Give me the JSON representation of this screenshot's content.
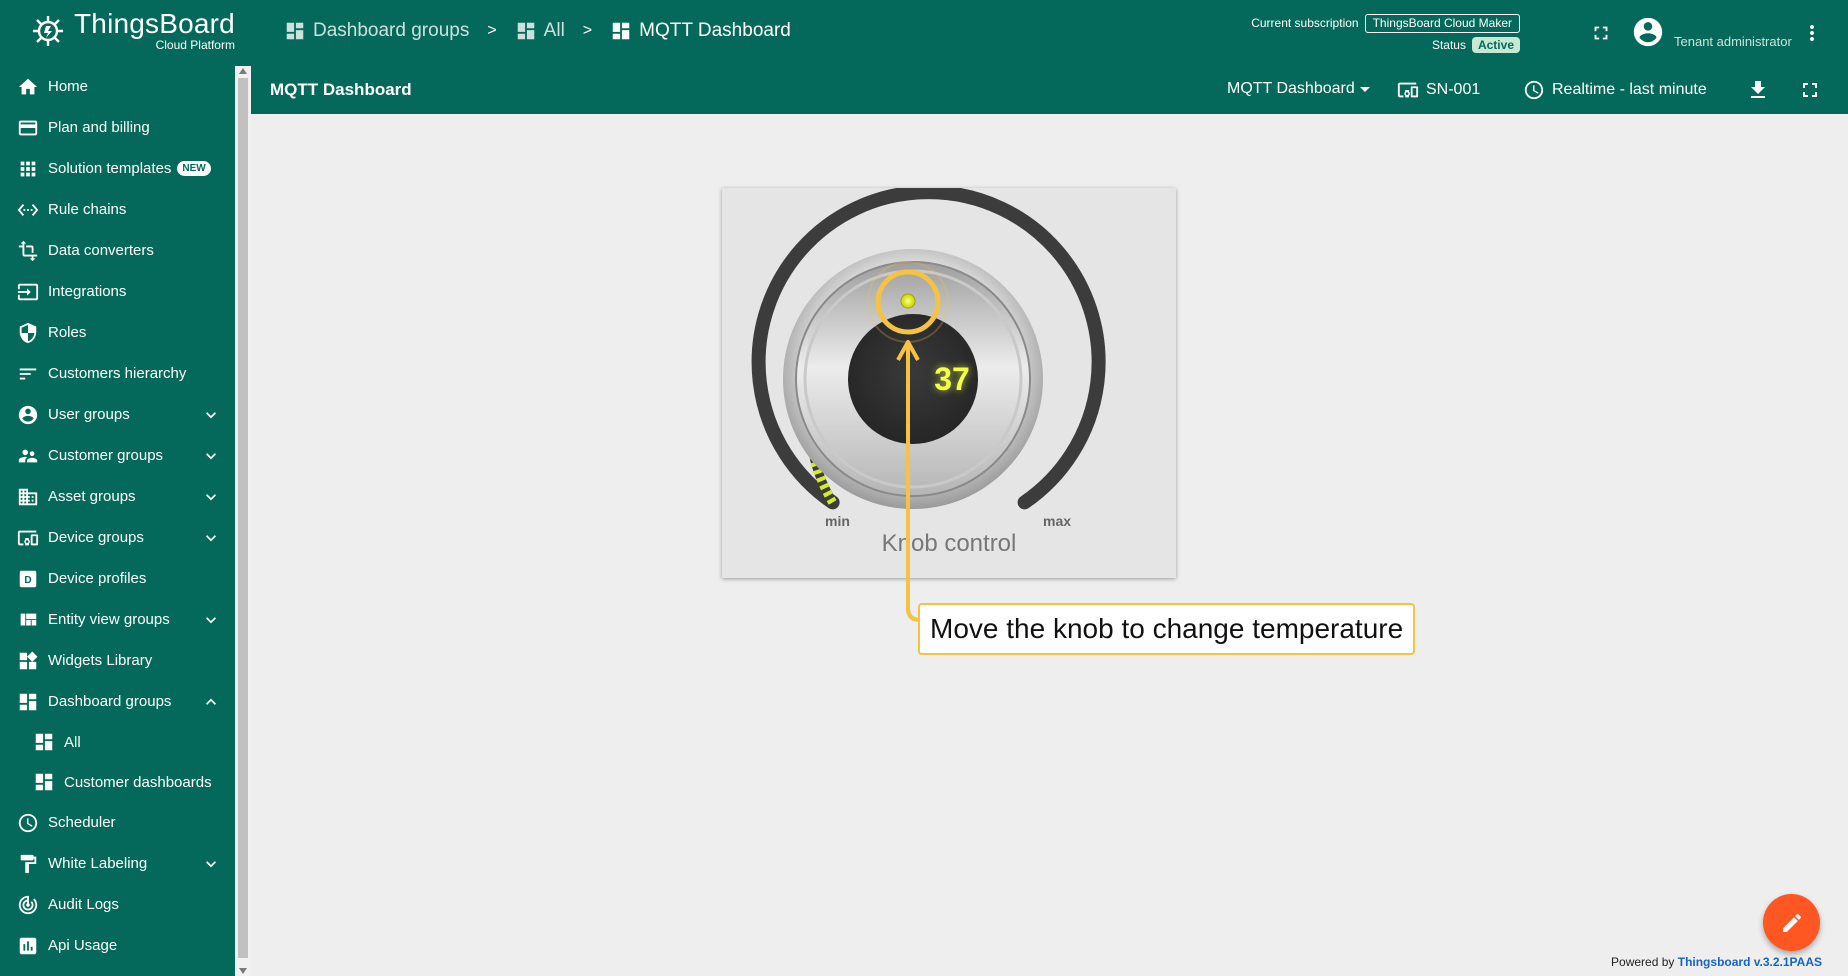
{
  "app": {
    "logo_title": "ThingsBoard",
    "logo_subtitle": "Cloud Platform",
    "logo_icon": "thingsboard-logo-icon"
  },
  "breadcrumb": {
    "items": [
      {
        "label": "Dashboard groups",
        "icon": "dashboard-icon"
      },
      {
        "label": "All",
        "icon": "dashboard-icon"
      },
      {
        "label": "MQTT Dashboard",
        "icon": "dashboard-icon"
      }
    ],
    "separator": ">"
  },
  "subscription": {
    "label": "Current subscription",
    "plan": "ThingsBoard Cloud Maker",
    "status_label": "Status",
    "status": "Active"
  },
  "user": {
    "role": "Tenant administrator",
    "avatar_icon": "account-circle-icon"
  },
  "sidebar": {
    "items": [
      {
        "label": "Home",
        "icon": "home-icon"
      },
      {
        "label": "Plan and billing",
        "icon": "credit-card-icon"
      },
      {
        "label": "Solution templates",
        "icon": "apps-grid-icon",
        "badge": "NEW"
      },
      {
        "label": "Rule chains",
        "icon": "settings-ethernet-icon"
      },
      {
        "label": "Data converters",
        "icon": "transform-icon"
      },
      {
        "label": "Integrations",
        "icon": "input-icon"
      },
      {
        "label": "Roles",
        "icon": "security-shield-icon"
      },
      {
        "label": "Customers hierarchy",
        "icon": "sort-icon"
      },
      {
        "label": "User groups",
        "icon": "account-circle-icon",
        "expandable": true
      },
      {
        "label": "Customer groups",
        "icon": "supervisor-account-icon",
        "expandable": true
      },
      {
        "label": "Asset groups",
        "icon": "domain-icon",
        "expandable": true
      },
      {
        "label": "Device groups",
        "icon": "devices-other-icon",
        "expandable": true
      },
      {
        "label": "Device profiles",
        "icon": "device-profile-icon"
      },
      {
        "label": "Entity view groups",
        "icon": "view-quilt-icon",
        "expandable": true
      },
      {
        "label": "Widgets Library",
        "icon": "widgets-icon"
      },
      {
        "label": "Dashboard groups",
        "icon": "dashboard-icon",
        "expanded": true
      },
      {
        "label": "All",
        "icon": "dashboard-icon",
        "sub": true
      },
      {
        "label": "Customer dashboards",
        "icon": "dashboard-icon",
        "sub": true
      },
      {
        "label": "Scheduler",
        "icon": "schedule-icon"
      },
      {
        "label": "White Labeling",
        "icon": "format-paint-icon",
        "expandable": true
      },
      {
        "label": "Audit Logs",
        "icon": "track-changes-icon"
      },
      {
        "label": "Api Usage",
        "icon": "insert-chart-icon"
      }
    ]
  },
  "dashboard": {
    "title": "MQTT Dashboard",
    "state_selector": "MQTT Dashboard",
    "entity_alias": "SN-001",
    "timewindow": "Realtime - last minute"
  },
  "widget": {
    "type": "knob-control",
    "title": "Knob control",
    "value": "37",
    "value_number": 37,
    "min_label": "min",
    "max_label": "max",
    "level_fraction": 0.37,
    "colors": {
      "active": "#d4f01b",
      "track": "#3c3c3c",
      "value": "#f4ff4a"
    }
  },
  "annotation": {
    "text": "Move the knob to change temperature",
    "color": "#f5c242"
  },
  "footer": {
    "powered_by": "Powered by",
    "link": "Thingsboard v.3.2.1PAAS"
  },
  "colors": {
    "primary": "#04695b",
    "fab": "#ff5722"
  }
}
